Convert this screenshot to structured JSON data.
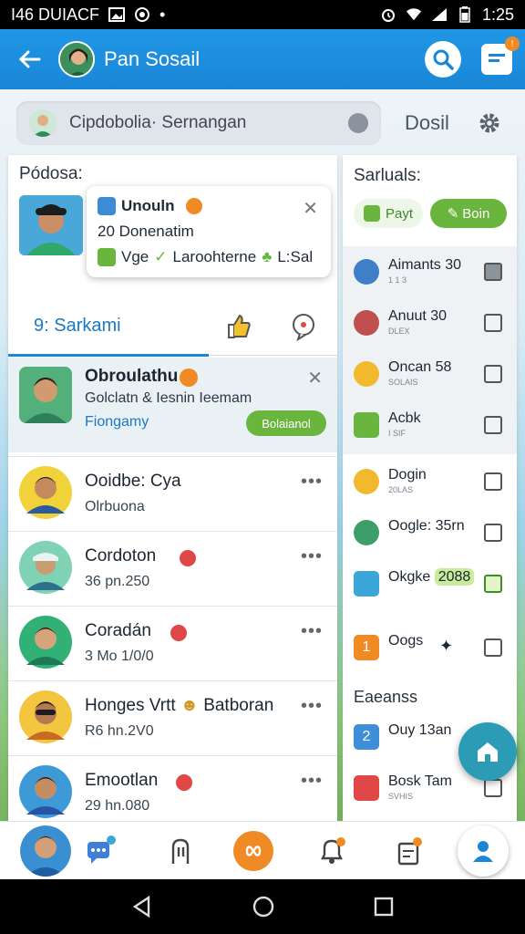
{
  "status_bar": {
    "left_text": "I46 DUIACF",
    "time": "1:25"
  },
  "app_bar": {
    "title": "Pan Sosail"
  },
  "search": {
    "value": "Cipdobolia· Sernangan",
    "side_label": "Dosil"
  },
  "left_panel": {
    "heading": "Pódosa:",
    "popup": {
      "title": "Unouln",
      "line2": "20 Donenatim",
      "line3_a": "Vge",
      "line3_b": "Laroohterne",
      "line3_c": "L:Sal"
    },
    "tab_label": "9: Sarkami",
    "highlight": {
      "name": "Obroulathu",
      "sub": "Golclatn & Iesnin Ieemam",
      "foot": "Fiongamy",
      "button": "Bolaianol"
    },
    "rows": [
      {
        "title": "Ooidbe: Cya",
        "sub": "Olrbuona"
      },
      {
        "title": "Cordoton",
        "sub": "36 pn.250"
      },
      {
        "title": "Coradán",
        "sub": "3 Mo 1/0/0"
      },
      {
        "title": "Honges Vrtt",
        "title_b": "Batboran",
        "sub": "R6 hn.2V0"
      },
      {
        "title": "Emootlan",
        "sub": "29 hn.080"
      }
    ]
  },
  "right_panel": {
    "heading": "Sarluals:",
    "chip1": "Payt",
    "chip2": "Boin",
    "group1": [
      {
        "label": "Aimants",
        "value": "30",
        "small": "1 1 3"
      },
      {
        "label": "Anuut",
        "value": "30",
        "small": "DLEX"
      },
      {
        "label": "Oncan",
        "value": "58",
        "small": "SOLAIS"
      },
      {
        "label": "Acbk",
        "value": "",
        "small": "I  SIF"
      }
    ],
    "group2": [
      {
        "label": "Dogin",
        "small": "20LAS"
      },
      {
        "label": "Oogle:",
        "value": "35rn"
      },
      {
        "label": "Okgke",
        "value": "2088"
      },
      {
        "label": "Oogs",
        "value": ""
      }
    ],
    "section2": "Eaeanss",
    "group3": [
      {
        "label": "Ouy",
        "value": "13an"
      },
      {
        "label": "Bosk Tam",
        "small": "SVHIS"
      }
    ],
    "num1": "1",
    "num2": "2"
  },
  "colors": {
    "primary": "#1a86d6",
    "accent": "#6ab53e",
    "orange": "#f08a24",
    "fab": "#2c9bb5"
  }
}
